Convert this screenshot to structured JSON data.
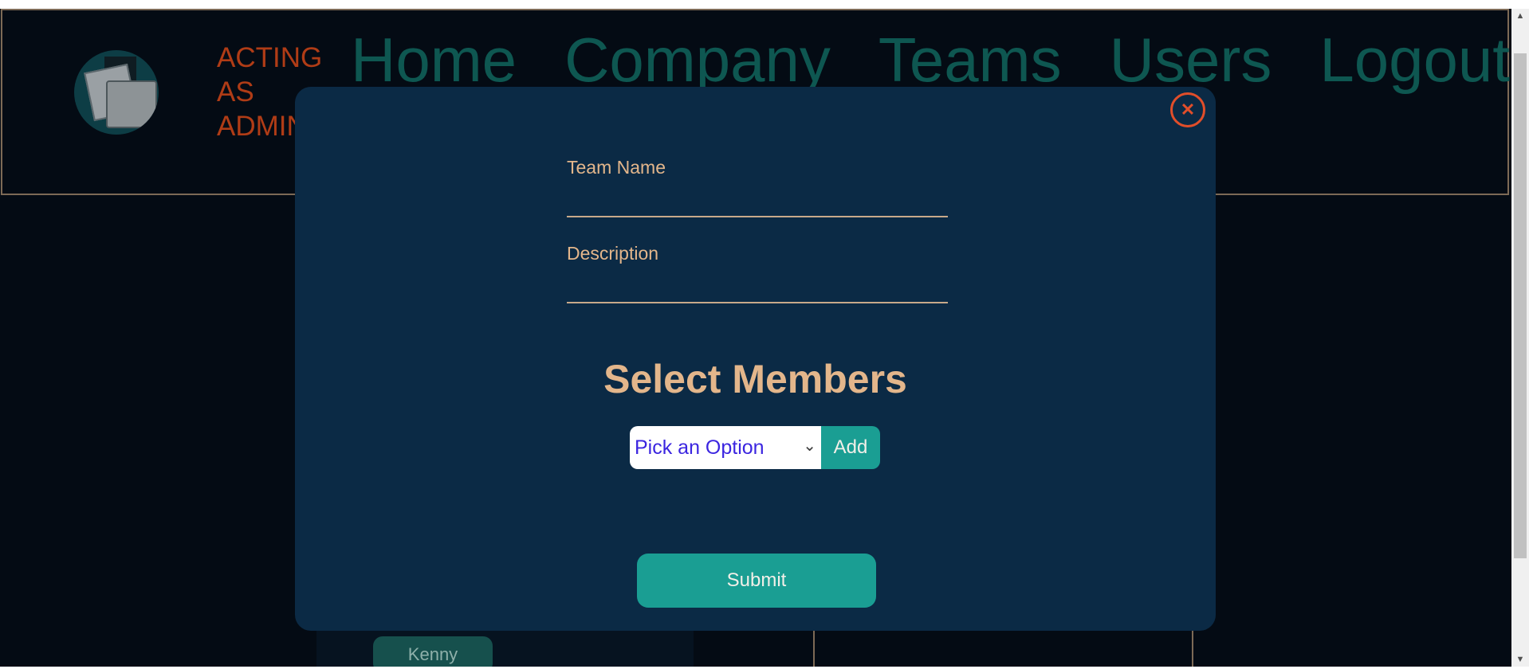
{
  "header": {
    "acting_line1": "ACTING",
    "acting_line2": "AS",
    "acting_line3": "ADMIN",
    "nav": [
      "Home",
      "Company",
      "Teams",
      "Users",
      "Logout"
    ]
  },
  "background": {
    "member_chip": "Kenny"
  },
  "modal": {
    "close_icon": "close-icon",
    "team_name_label": "Team Name",
    "team_name_value": "",
    "description_label": "Description",
    "description_value": "",
    "select_members_title": "Select Members",
    "member_select_value": "Pick an Option",
    "add_label": "Add",
    "submit_label": "Submit"
  },
  "colors": {
    "background": "#040b14",
    "modal": "#0b2a45",
    "accent": "#1a9e93",
    "label": "#e3b68b",
    "admin_text": "#b03c16",
    "close": "#e14e2a"
  }
}
